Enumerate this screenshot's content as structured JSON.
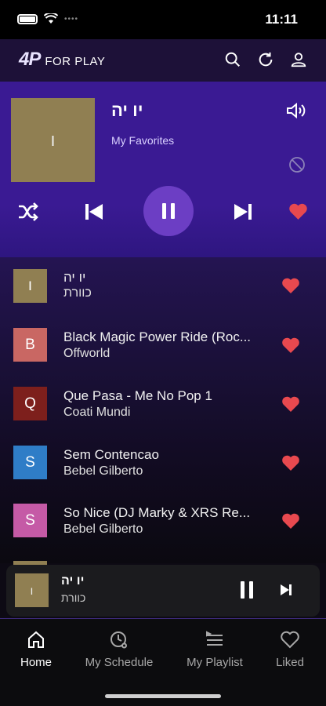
{
  "status": {
    "time": "11:11"
  },
  "header": {
    "logo_mark": "4P",
    "logo_text": "FOR PLAY"
  },
  "now_playing": {
    "title": "יו יה",
    "subtitle": "My Favorites",
    "art_letter": "ו"
  },
  "tracks": [
    {
      "title": "יו יה",
      "artist": "כוורת",
      "letter": "ו",
      "color": "#907f52"
    },
    {
      "title": "Black Magic Power Ride (Roc...",
      "artist": "Offworld",
      "letter": "B",
      "color": "#c96763"
    },
    {
      "title": "Que Pasa - Me No Pop 1",
      "artist": "Coati Mundi",
      "letter": "Q",
      "color": "#7d1f1c"
    },
    {
      "title": "Sem Contencao",
      "artist": "Bebel Gilberto",
      "letter": "S",
      "color": "#2f7dc7"
    },
    {
      "title": "So Nice (DJ Marky & XRS Re...",
      "artist": "Bebel Gilberto",
      "letter": "S",
      "color": "#c55aa6"
    }
  ],
  "mini_player": {
    "title": "יו יה",
    "artist": "כוורת",
    "art_letter": "ו"
  },
  "tabs": [
    {
      "label": "Home",
      "icon": "home-icon",
      "active": true
    },
    {
      "label": "My Schedule",
      "icon": "schedule-icon",
      "active": false
    },
    {
      "label": "My Playlist",
      "icon": "playlist-icon",
      "active": false
    },
    {
      "label": "Liked",
      "icon": "heart-icon",
      "active": false
    }
  ],
  "colors": {
    "accent": "#6c3ec4",
    "heart": "#e8494f",
    "player_bg": "#3a1a93"
  }
}
